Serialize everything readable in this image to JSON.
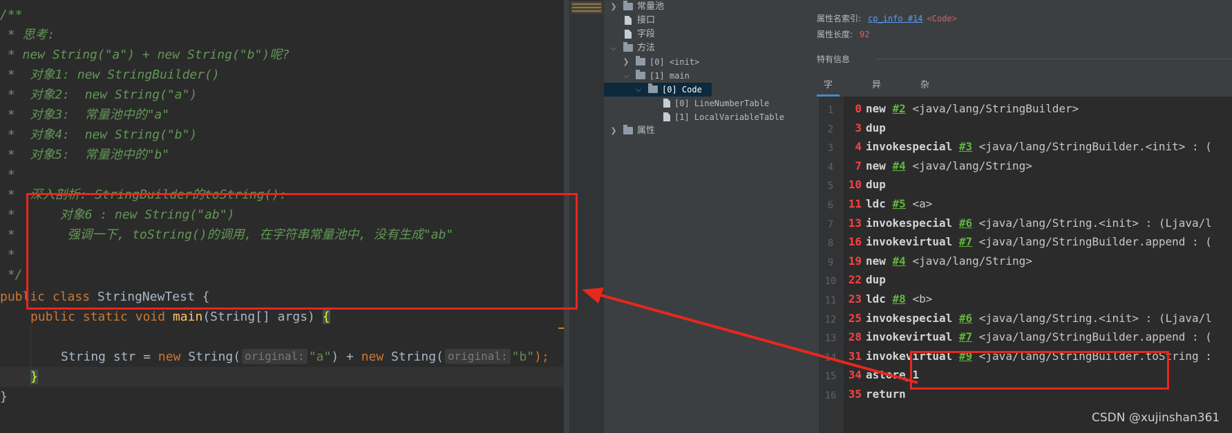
{
  "editor": {
    "comment": {
      "open": "/**",
      "l1": " * 思考:",
      "l2": " * new String(\"a\") + new String(\"b\")呢?",
      "l3": " *  对象1: new StringBuilder()",
      "l4": " *  对象2:  new String(\"a\")",
      "l5": " *  对象3:  常量池中的\"a\"",
      "l6": " *  对象4:  new String(\"b\")",
      "l7": " *  对象5:  常量池中的\"b\"",
      "l8": " *",
      "l9": " *  深入剖析: StringBuilder的toString():",
      "l10": " *      对象6 : new String(\"ab\")",
      "l11": " *       强调一下, toString()的调用, 在字符串常量池中, 没有生成\"ab\"",
      "l12": " *",
      "close": " */"
    },
    "class_decl": {
      "kw1": "public",
      "kw2": "class",
      "name": "StringNewTest",
      "brace": "{"
    },
    "main_decl": {
      "kw1": "public",
      "kw2": "static",
      "kw3": "void",
      "name": "main",
      "params": "(String[] args) ",
      "brace": "{"
    },
    "stmt": {
      "type": "String str = ",
      "new1": "new",
      "ctor1": " String(",
      "hint1": "original:",
      "arg1": "\"a\"",
      "mid": ") + ",
      "new2": "new",
      "ctor2": " String(",
      "hint2": "original:",
      "arg2": "\"b\"",
      "end": ");"
    },
    "close_method": "}",
    "close_class": "}"
  },
  "tree": {
    "items": [
      {
        "label": "常量池"
      },
      {
        "label": "接口"
      },
      {
        "label": "字段"
      },
      {
        "label": "方法"
      },
      {
        "label": "[0] <init>"
      },
      {
        "label": "[1] main"
      },
      {
        "label": "[0] Code"
      },
      {
        "label": "[0] LineNumberTable"
      },
      {
        "label": "[1] LocalVariableTable"
      },
      {
        "label": "属性"
      }
    ]
  },
  "info": {
    "name_index_label": "属性名索引:",
    "name_index_link": "cp_info #14",
    "name_index_tag": "<Code>",
    "length_label": "属性长度:",
    "length_value": "92",
    "special_label": "特有信息",
    "tabs": [
      "字节码",
      "异常表",
      "杂项"
    ]
  },
  "bytecode": {
    "lines": [
      {
        "no": "1",
        "off": "0",
        "instr": "new",
        "ref": "#2",
        "arg": "<java/lang/StringBuilder>"
      },
      {
        "no": "2",
        "off": "3",
        "instr": "dup",
        "ref": "",
        "arg": ""
      },
      {
        "no": "3",
        "off": "4",
        "instr": "invokespecial",
        "ref": "#3",
        "arg": "<java/lang/StringBuilder.<init> : ("
      },
      {
        "no": "4",
        "off": "7",
        "instr": "new",
        "ref": "#4",
        "arg": "<java/lang/String>"
      },
      {
        "no": "5",
        "off": "10",
        "instr": "dup",
        "ref": "",
        "arg": ""
      },
      {
        "no": "6",
        "off": "11",
        "instr": "ldc",
        "ref": "#5",
        "arg": "<a>"
      },
      {
        "no": "7",
        "off": "13",
        "instr": "invokespecial",
        "ref": "#6",
        "arg": "<java/lang/String.<init> : (Ljava/l"
      },
      {
        "no": "8",
        "off": "16",
        "instr": "invokevirtual",
        "ref": "#7",
        "arg": "<java/lang/StringBuilder.append : ("
      },
      {
        "no": "9",
        "off": "19",
        "instr": "new",
        "ref": "#4",
        "arg": "<java/lang/String>"
      },
      {
        "no": "10",
        "off": "22",
        "instr": "dup",
        "ref": "",
        "arg": ""
      },
      {
        "no": "11",
        "off": "23",
        "instr": "ldc",
        "ref": "#8",
        "arg": "<b>"
      },
      {
        "no": "12",
        "off": "25",
        "instr": "invokespecial",
        "ref": "#6",
        "arg": "<java/lang/String.<init> : (Ljava/l"
      },
      {
        "no": "13",
        "off": "28",
        "instr": "invokevirtual",
        "ref": "#7",
        "arg": "<java/lang/StringBuilder.append : ("
      },
      {
        "no": "14",
        "off": "31",
        "instr": "invokevirtual",
        "ref": "#9",
        "arg": "<java/lang/StringBuilder.toString :"
      },
      {
        "no": "15",
        "off": "34",
        "instr": "astore_1",
        "ref": "",
        "arg": ""
      },
      {
        "no": "16",
        "off": "35",
        "instr": "return",
        "ref": "",
        "arg": ""
      }
    ]
  },
  "watermark": "CSDN @xujinshan361",
  "colors": {
    "annotation": "#e8271e",
    "comment": "#629755",
    "keyword": "#cc7832",
    "offset": "#ff4040",
    "ref": "#5fb83e"
  }
}
